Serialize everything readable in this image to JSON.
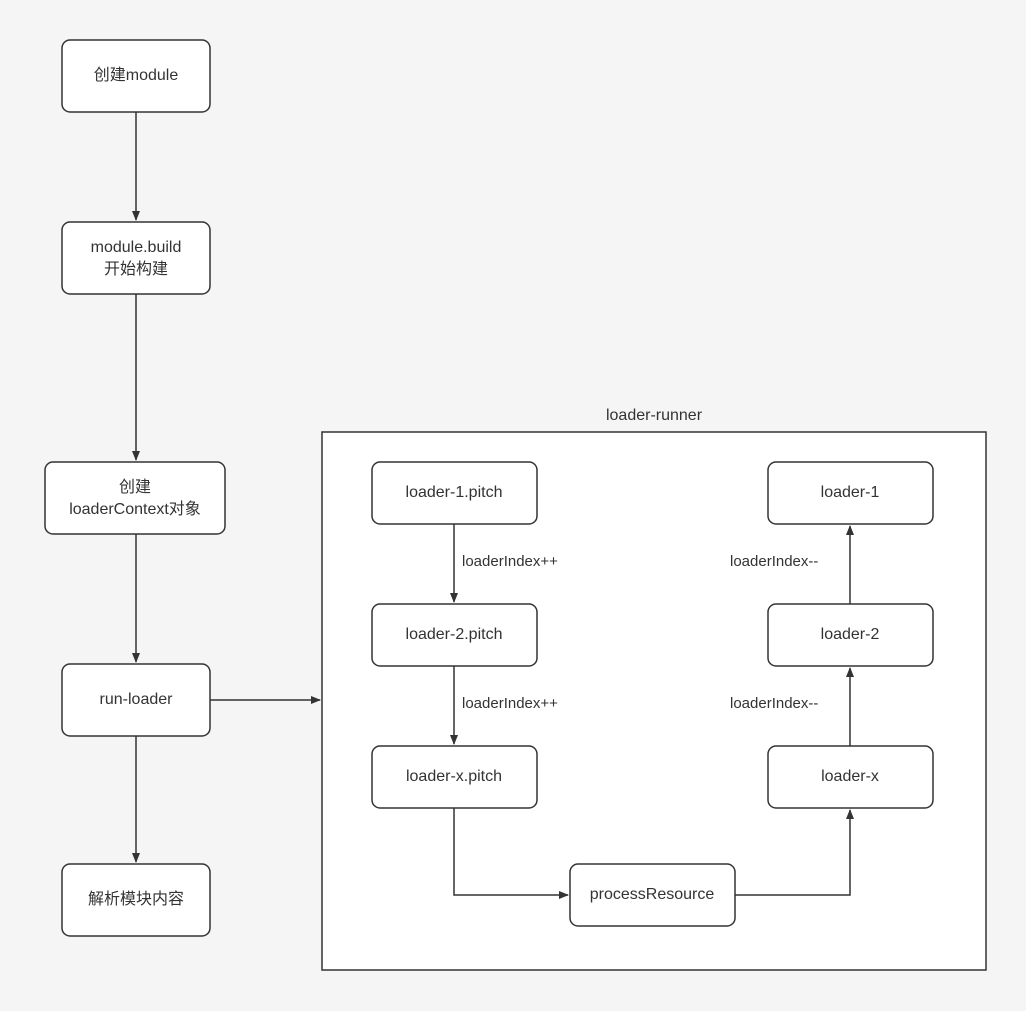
{
  "diagram": {
    "title": "loader-runner",
    "left_chain": {
      "n1": "创建module",
      "n2_line1": "module.build",
      "n2_line2": "开始构建",
      "n3_line1": "创建",
      "n3_line2": "loaderContext对象",
      "n4": "run-loader",
      "n5": "解析模块内容"
    },
    "runner": {
      "p1": "loader-1.pitch",
      "p2": "loader-2.pitch",
      "p3": "loader-x.pitch",
      "proc": "processResource",
      "l3": "loader-x",
      "l2": "loader-2",
      "l1": "loader-1",
      "inc1": "loaderIndex++",
      "inc2": "loaderIndex++",
      "dec1": "loaderIndex--",
      "dec2": "loaderIndex--"
    }
  }
}
